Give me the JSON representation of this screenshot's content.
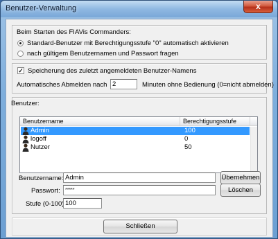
{
  "window": {
    "title": "Benutzer-Verwaltung",
    "close_glyph": "x"
  },
  "startup": {
    "heading": "Beim Starten des FIAVis Commanders:",
    "option_default": "Standard-Benutzer mit Berechtigungsstufe \"0\" automatisch aktivieren",
    "option_ask": "nach gültigem Benutzernamen und Passwort fragen",
    "selected": "default"
  },
  "options": {
    "save_username_label": "Speicherung des zuletzt angemeldeten Benutzer-Namens",
    "save_username_checked": true,
    "auto_logout_prefix": "Automatisches Abmelden nach",
    "auto_logout_value": "2",
    "auto_logout_suffix": "Minuten ohne Bedienung (0=nicht abmelden)"
  },
  "users": {
    "heading": "Benutzer:",
    "columns": {
      "name": "Benutzername",
      "level": "Berechtigungsstufe"
    },
    "rows": [
      {
        "name": "Admin",
        "level": "100",
        "selected": true
      },
      {
        "name": "logoff",
        "level": "0",
        "selected": false
      },
      {
        "name": "Nutzer",
        "level": "50",
        "selected": false
      }
    ]
  },
  "form": {
    "username_label": "Benutzername:",
    "username_value": "Admin",
    "password_label": "Passwort:",
    "password_value": "*****",
    "level_label": "Stufe (0-100):",
    "level_value": "100",
    "apply_button": "Übernehmen",
    "delete_button": "Löschen"
  },
  "footer": {
    "close_button": "Schließen"
  },
  "colors": {
    "selection": "#3399ff",
    "title_gradient_top": "#c3dcf3",
    "close_red": "#c7432a"
  }
}
